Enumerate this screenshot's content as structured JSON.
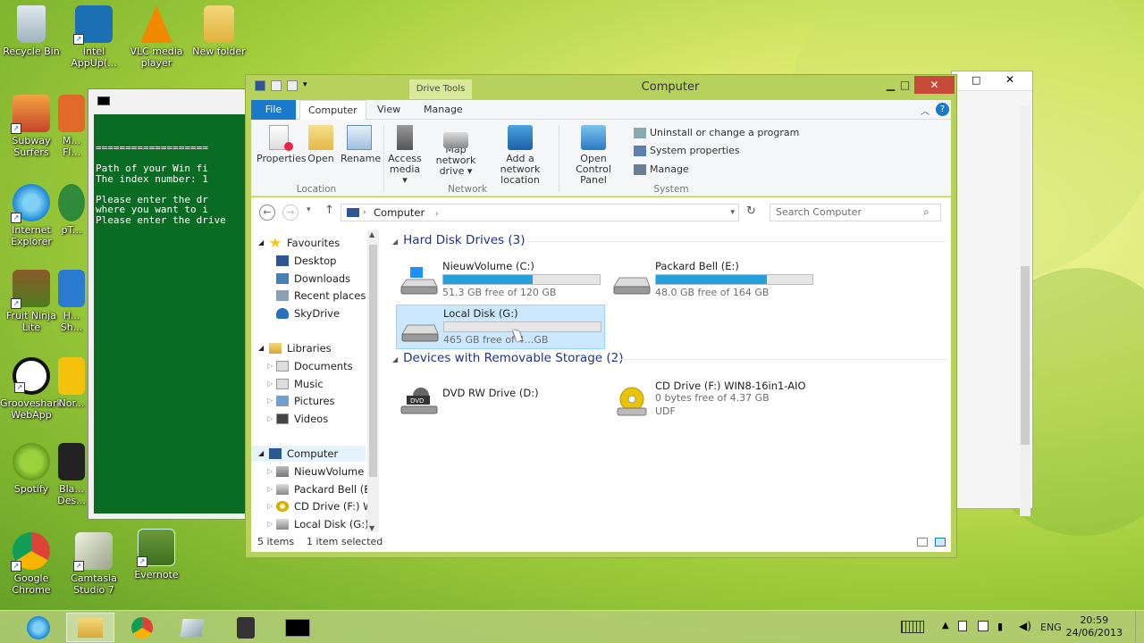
{
  "desktop": {
    "icons": [
      {
        "label": "Recycle Bin"
      },
      {
        "label": "Intel AppUp(..."
      },
      {
        "label": "VLC media player"
      },
      {
        "label": "New folder"
      },
      {
        "label": "Subway Surfers"
      },
      {
        "label": "M... Fl..."
      },
      {
        "label": "Internet Explorer"
      },
      {
        "label": "pT..."
      },
      {
        "label": "Fruit Ninja Lite"
      },
      {
        "label": "H... Sh..."
      },
      {
        "label": "Grooveshark WebApp"
      },
      {
        "label": "Nor..."
      },
      {
        "label": "Spotify"
      },
      {
        "label": "Bla... Des..."
      },
      {
        "label": "Google Chrome"
      },
      {
        "label": "Camtasia Studio 7"
      },
      {
        "label": "Evernote"
      }
    ]
  },
  "console": {
    "lines": "===================\n\nPath of your Win fi\nThe index number: 1\n\nPlease enter the dr\nwhere you want to i\nPlease enter the drive"
  },
  "explorer": {
    "title": "Computer",
    "drive_tools": "Drive Tools",
    "tabs": {
      "file": "File",
      "computer": "Computer",
      "view": "View",
      "manage": "Manage"
    },
    "ribbon": {
      "properties": "Properties",
      "open": "Open",
      "rename": "Rename",
      "location": "Location",
      "access_media_1": "Access",
      "access_media_2": "media ▾",
      "map_network_1": "Map network",
      "map_network_2": "drive ▾",
      "add_location_1": "Add a network",
      "add_location_2": "location",
      "network": "Network",
      "open_cp_1": "Open Control",
      "open_cp_2": "Panel",
      "uninstall": "Uninstall or change a program",
      "system_properties": "System properties",
      "manage": "Manage",
      "system": "System"
    },
    "address": "Computer",
    "search_placeholder": "Search Computer",
    "nav": {
      "favourites": "Favourites",
      "desktop": "Desktop",
      "downloads": "Downloads",
      "recent": "Recent places",
      "skydrive": "SkyDrive",
      "libraries": "Libraries",
      "documents": "Documents",
      "music": "Music",
      "pictures": "Pictures",
      "videos": "Videos",
      "computer": "Computer",
      "drive_c": "NieuwVolume (C",
      "drive_e": "Packard Bell (E:)",
      "drive_f": "CD Drive (F:) WI",
      "drive_g": "Local Disk (G:)"
    },
    "groups": {
      "hdd": "Hard Disk Drives (3)",
      "removable": "Devices with Removable Storage (2)"
    },
    "drives": {
      "c": {
        "name": "NieuwVolume (C:)",
        "free": "51.3 GB free of 120 GB",
        "used_fraction": 0.57
      },
      "e": {
        "name": "Packard Bell (E:)",
        "free": "48.0 GB free of 164 GB",
        "used_fraction": 0.71
      },
      "g": {
        "name": "Local Disk (G:)",
        "free": "465 GB free of 4…GB",
        "used_fraction": 0.0
      },
      "d": {
        "name": "DVD RW Drive (D:)"
      },
      "f": {
        "name": "CD Drive (F:) WIN8-16in1-AIO",
        "free": "0 bytes free of 4.37 GB",
        "fs": "UDF"
      }
    },
    "status": {
      "items": "5 items",
      "selected": "1 item selected"
    }
  },
  "taskbar": {
    "lang": "ENG",
    "time": "20:59",
    "date": "24/06/2013"
  },
  "colors": {
    "accent": "#1979ca",
    "progress": "#26a0da",
    "console_bg": "#0a6b22",
    "window_frame": "#b7d25c"
  }
}
